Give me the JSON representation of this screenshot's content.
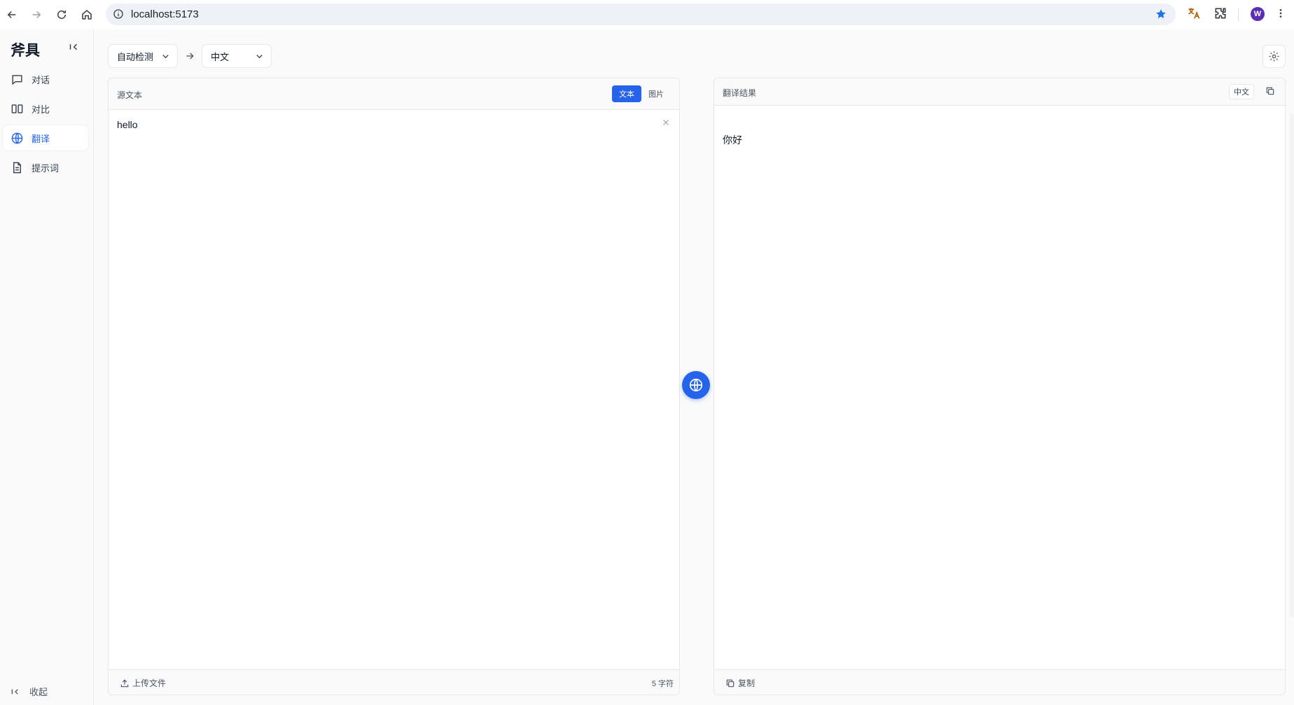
{
  "browser": {
    "url": "localhost:5173",
    "profile_initial": "W"
  },
  "sidebar": {
    "brand": "斧具",
    "items": [
      {
        "label": "对话",
        "icon": "chat-bubble-icon",
        "active": false
      },
      {
        "label": "对比",
        "icon": "columns-icon",
        "active": false
      },
      {
        "label": "翻译",
        "icon": "globe-icon",
        "active": true
      },
      {
        "label": "提示词",
        "icon": "document-icon",
        "active": false
      }
    ],
    "collapse_label": "收起"
  },
  "toolbar": {
    "source_lang": "自动检测",
    "target_lang": "中文"
  },
  "source_panel": {
    "title": "源文本",
    "modes": [
      "文本",
      "图片"
    ],
    "active_mode": "文本",
    "text": "hello",
    "upload_label": "上传文件",
    "char_count": "5 字符"
  },
  "result_panel": {
    "title": "翻译结果",
    "lang_badge": "中文",
    "text": "你好",
    "copy_label": "复制"
  },
  "colors": {
    "accent": "#2563eb",
    "profile": "#5b2fb3"
  }
}
